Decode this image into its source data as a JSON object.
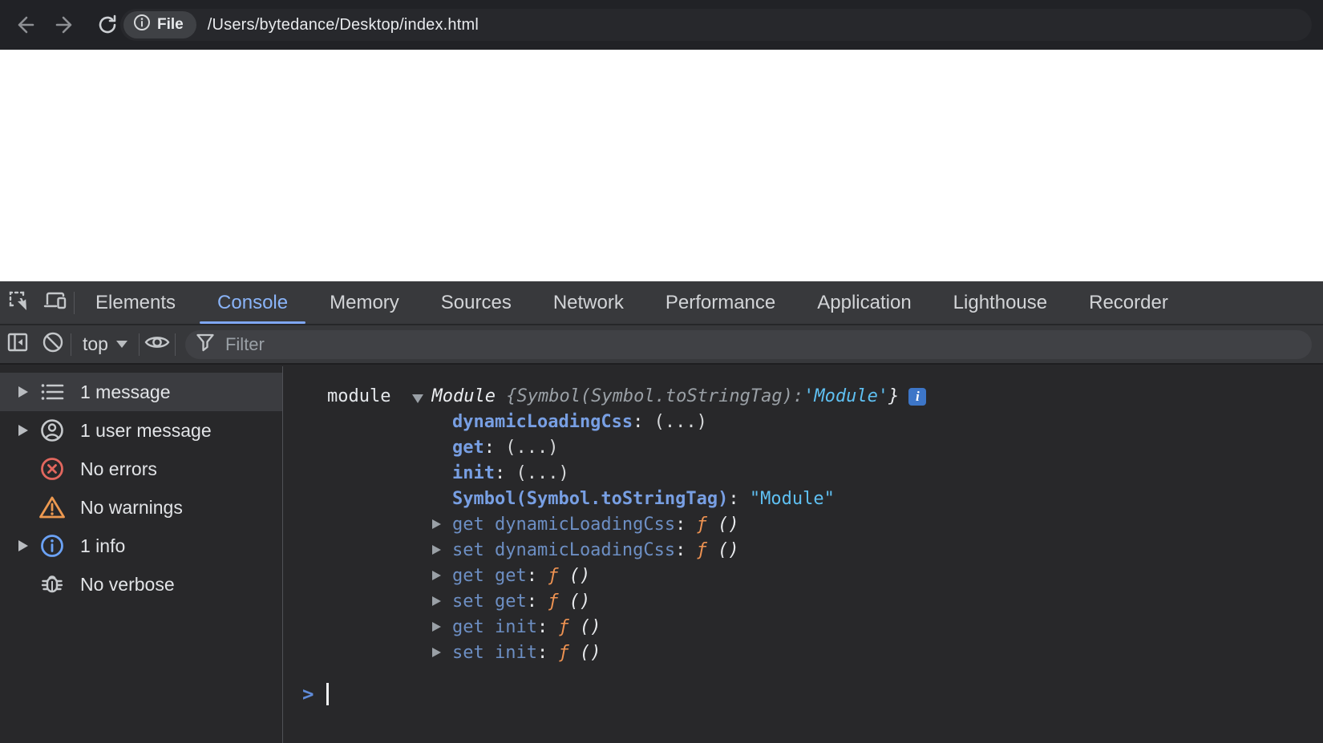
{
  "browser": {
    "nav": {
      "back": "back-arrow",
      "forward": "forward-arrow",
      "reload": "reload"
    },
    "scheme_chip": "File",
    "url": "/Users/bytedance/Desktop/index.html"
  },
  "devtools": {
    "tabs": [
      {
        "label": "Elements",
        "active": false
      },
      {
        "label": "Console",
        "active": true
      },
      {
        "label": "Memory",
        "active": false
      },
      {
        "label": "Sources",
        "active": false
      },
      {
        "label": "Network",
        "active": false
      },
      {
        "label": "Performance",
        "active": false
      },
      {
        "label": "Application",
        "active": false
      },
      {
        "label": "Lighthouse",
        "active": false
      },
      {
        "label": "Recorder",
        "active": false
      }
    ],
    "toolbar": {
      "context_selector": "top",
      "filter_placeholder": "Filter"
    },
    "sidebar": {
      "items": [
        {
          "label": "1 message",
          "icon": "list-icon",
          "expandable": true,
          "selected": true
        },
        {
          "label": "1 user message",
          "icon": "user-icon",
          "expandable": true,
          "selected": false
        },
        {
          "label": "No errors",
          "icon": "error-icon",
          "expandable": false,
          "selected": false
        },
        {
          "label": "No warnings",
          "icon": "warning-icon",
          "expandable": false,
          "selected": false
        },
        {
          "label": "1 info",
          "icon": "info-icon",
          "expandable": true,
          "selected": false
        },
        {
          "label": "No verbose",
          "icon": "bug-icon",
          "expandable": false,
          "selected": false
        }
      ]
    },
    "console": {
      "logged_name": "module",
      "preview": {
        "class_name": "Module",
        "body": "{Symbol(Symbol.toStringTag): ",
        "string_value": "'Module'",
        "close": "}",
        "badge": "i"
      },
      "punct": {
        "colon": ": ",
        "space": " "
      },
      "properties": [
        {
          "name": "dynamicLoadingCss",
          "value": "(...)"
        },
        {
          "name": "get",
          "value": "(...)"
        },
        {
          "name": "init",
          "value": "(...)"
        },
        {
          "name": "Symbol(Symbol.toStringTag)",
          "value": "\"Module\""
        },
        {
          "name": "get dynamicLoadingCss",
          "fn": "ƒ",
          "args": "()"
        },
        {
          "name": "set dynamicLoadingCss",
          "fn": "ƒ",
          "args": "()"
        },
        {
          "name": "get get",
          "fn": "ƒ",
          "args": "()"
        },
        {
          "name": "set get",
          "fn": "ƒ",
          "args": "()"
        },
        {
          "name": "get init",
          "fn": "ƒ",
          "args": "()"
        },
        {
          "name": "set init",
          "fn": "ƒ",
          "args": "()"
        }
      ],
      "prompt_char": ">"
    },
    "colors": {
      "accent_blue": "#8ab4f8",
      "property_blue": "#789fe3",
      "getter_blue": "#6d8fc4",
      "string_cyan": "#5fc0f2",
      "function_orange": "#ef9352",
      "error_red": "#e2675e",
      "warning_orange": "#ed9950",
      "info_blue": "#6ba2f5",
      "panel_bg": "#28282a",
      "toolbar_bg": "#38393c"
    }
  }
}
